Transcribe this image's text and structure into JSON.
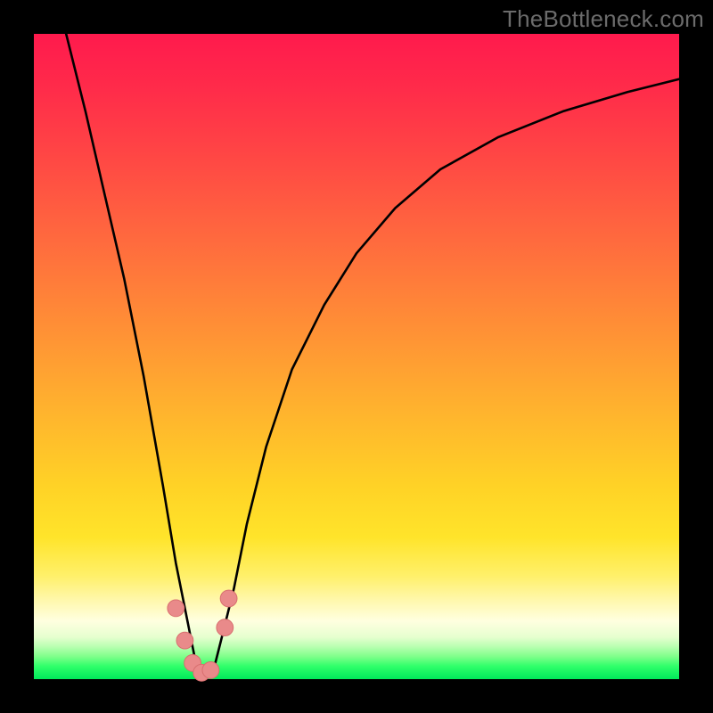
{
  "watermark": {
    "text": "TheBottleneck.com"
  },
  "colors": {
    "curve_stroke": "#000000",
    "marker_fill": "#e98a8a",
    "marker_stroke": "#d86f6f",
    "gradient_top": "#ff1a4d",
    "gradient_bottom": "#00e95a",
    "frame": "#000000"
  },
  "chart_data": {
    "type": "line",
    "title": "",
    "xlabel": "",
    "ylabel": "",
    "xlim": [
      0,
      100
    ],
    "ylim": [
      0,
      100
    ],
    "grid": false,
    "legend": false,
    "note": "Axes unlabeled in source image; values are normalized 0-100 estimates of the plotted V-shaped bottleneck curve. y≈0 near x≈26 (minimum), rising steeply on both sides.",
    "series": [
      {
        "name": "bottleneck-curve",
        "x": [
          5,
          8,
          11,
          14,
          17,
          20,
          22,
          24,
          25,
          26,
          27,
          28,
          29,
          31,
          33,
          36,
          40,
          45,
          50,
          56,
          63,
          72,
          82,
          92,
          100
        ],
        "y": [
          100,
          88,
          75,
          62,
          47,
          30,
          18,
          8,
          3,
          0.5,
          0.5,
          2,
          6,
          14,
          24,
          36,
          48,
          58,
          66,
          73,
          79,
          84,
          88,
          91,
          93
        ]
      }
    ],
    "markers": {
      "name": "highlight-dots",
      "note": "Salmon-pink cluster near the curve minimum",
      "points": [
        {
          "x": 22.0,
          "y": 11.0
        },
        {
          "x": 23.4,
          "y": 6.0
        },
        {
          "x": 24.6,
          "y": 2.5
        },
        {
          "x": 26.0,
          "y": 1.0
        },
        {
          "x": 27.4,
          "y": 1.4
        },
        {
          "x": 29.6,
          "y": 8.0
        },
        {
          "x": 30.2,
          "y": 12.5
        }
      ],
      "radius_pct": 1.3
    }
  }
}
